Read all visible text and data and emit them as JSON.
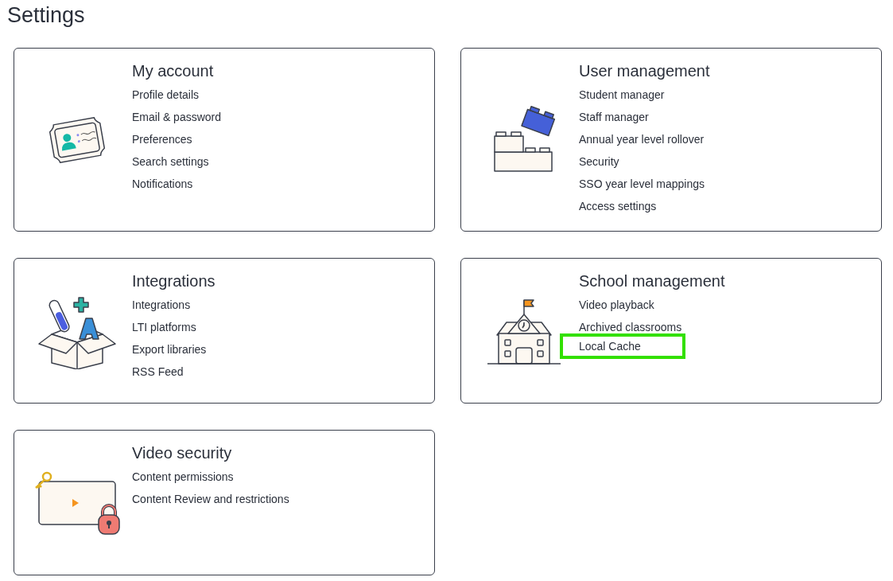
{
  "page": {
    "title": "Settings"
  },
  "cards": [
    {
      "kind": "id-card",
      "title": "My account",
      "links": [
        {
          "label": "Profile details",
          "highlighted": false
        },
        {
          "label": "Email & password",
          "highlighted": false
        },
        {
          "label": "Preferences",
          "highlighted": false
        },
        {
          "label": "Search settings",
          "highlighted": false
        },
        {
          "label": "Notifications",
          "highlighted": false
        }
      ]
    },
    {
      "kind": "blocks",
      "title": "User management",
      "links": [
        {
          "label": "Student manager",
          "highlighted": false
        },
        {
          "label": "Staff manager",
          "highlighted": false
        },
        {
          "label": "Annual year level rollover",
          "highlighted": false
        },
        {
          "label": "Security",
          "highlighted": false
        },
        {
          "label": "SSO year level mappings",
          "highlighted": false
        },
        {
          "label": "Access settings",
          "highlighted": false
        }
      ]
    },
    {
      "kind": "box",
      "title": "Integrations",
      "links": [
        {
          "label": "Integrations",
          "highlighted": false
        },
        {
          "label": "LTI platforms",
          "highlighted": false
        },
        {
          "label": "Export libraries",
          "highlighted": false
        },
        {
          "label": "RSS Feed",
          "highlighted": false
        }
      ]
    },
    {
      "kind": "school",
      "title": "School management",
      "links": [
        {
          "label": "Video playback",
          "highlighted": false
        },
        {
          "label": "Archived classrooms",
          "highlighted": false
        },
        {
          "label": "Local Cache",
          "highlighted": true
        }
      ]
    },
    {
      "kind": "video-lock",
      "title": "Video security",
      "links": [
        {
          "label": "Content permissions",
          "highlighted": false
        },
        {
          "label": "Content Review and restrictions",
          "highlighted": false
        }
      ]
    }
  ]
}
